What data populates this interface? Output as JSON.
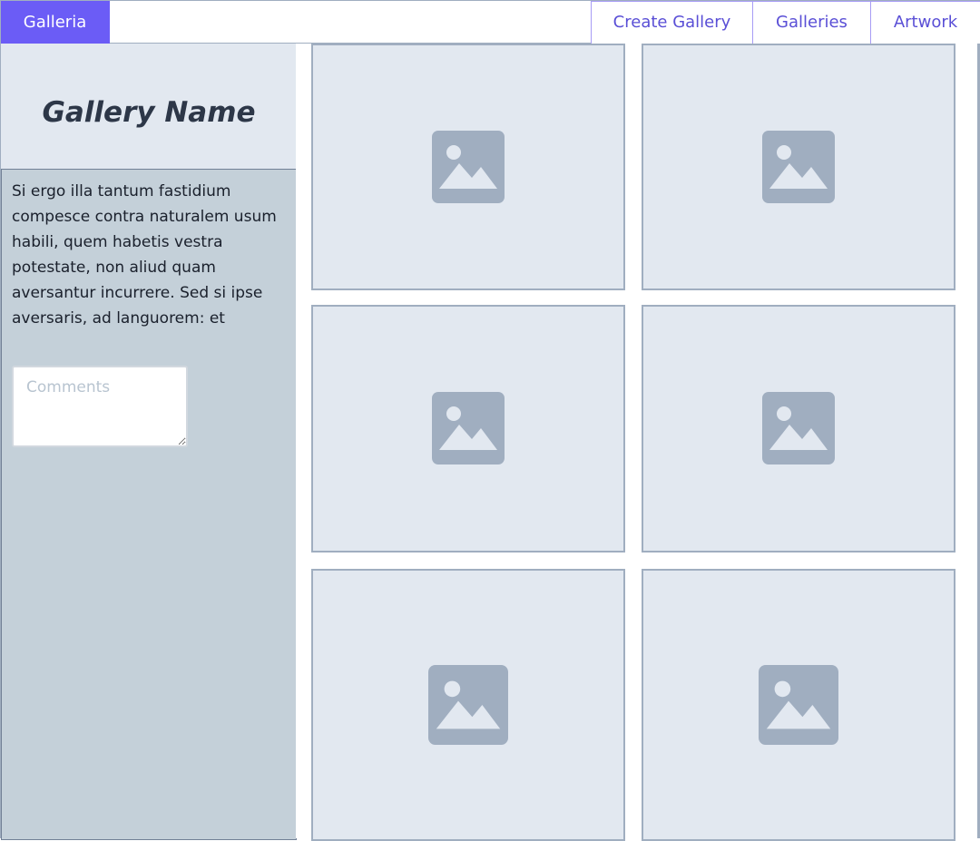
{
  "header": {
    "brand": "Galleria",
    "nav": {
      "create_gallery": "Create Gallery",
      "galleries": "Galleries",
      "artwork": "Artwork"
    }
  },
  "sidebar": {
    "gallery_name": "Gallery Name",
    "description": "Si ergo illa tantum fastidium compesce contra naturalem usum habili, quem habetis vestra potestate, non aliud quam aversantur incurrere. Sed si ipse aversaris, ad languorem: et",
    "comments_placeholder": "Comments"
  },
  "gallery": {
    "tiles": [
      {
        "icon": "image-placeholder-icon"
      },
      {
        "icon": "image-placeholder-icon"
      },
      {
        "icon": "image-placeholder-icon"
      },
      {
        "icon": "image-placeholder-icon"
      },
      {
        "icon": "image-placeholder-icon"
      },
      {
        "icon": "image-placeholder-icon"
      }
    ]
  },
  "colors": {
    "brand": "#6b5cf6",
    "nav_text": "#5a4fd6",
    "panel": "#c4d0d9",
    "tile": "#e2e8f0",
    "icon": "#a0aec0"
  }
}
